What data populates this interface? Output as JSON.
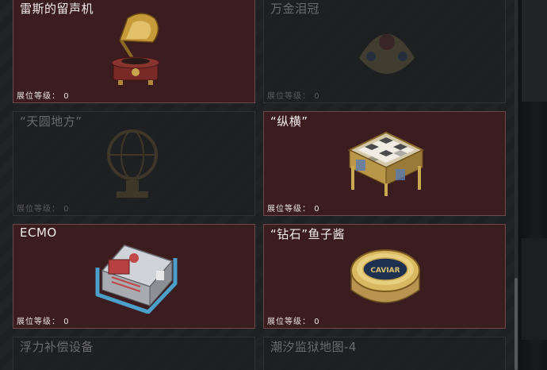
{
  "cards": [
    {
      "title": "雷斯的留声机",
      "level_label": "展位等级：",
      "level_value": "0",
      "state": "owned"
    },
    {
      "title": "万金泪冠",
      "level_label": "展位等级：",
      "level_value": "0",
      "state": "locked"
    },
    {
      "title": "“天圆地方”",
      "level_label": "展位等级：",
      "level_value": "0",
      "state": "locked"
    },
    {
      "title": "“纵横”",
      "level_label": "展位等级：",
      "level_value": "0",
      "state": "owned"
    },
    {
      "title": "ECMO",
      "level_label": "展位等级：",
      "level_value": "0",
      "state": "owned"
    },
    {
      "title": "“钻石”鱼子酱",
      "level_label": "展位等级：",
      "level_value": "0",
      "state": "owned"
    },
    {
      "title": "浮力补偿设备",
      "state": "locked"
    },
    {
      "title": "潮汐监狱地图-4",
      "state": "locked"
    }
  ],
  "icons": {
    "card1": "gramophone-icon",
    "card2": "jeweled-crown-icon",
    "card3": "globe-icon",
    "card4": "chess-board-icon",
    "card5": "ecmo-machine-icon",
    "card6": "caviar-tin-icon"
  },
  "caviar_label": "CAVIAR",
  "colors": {
    "owned_bg": "#3b1c1f",
    "locked_bg": "#1e1f21",
    "text_owned": "#f1ecec",
    "text_locked": "#6b6b6c"
  }
}
